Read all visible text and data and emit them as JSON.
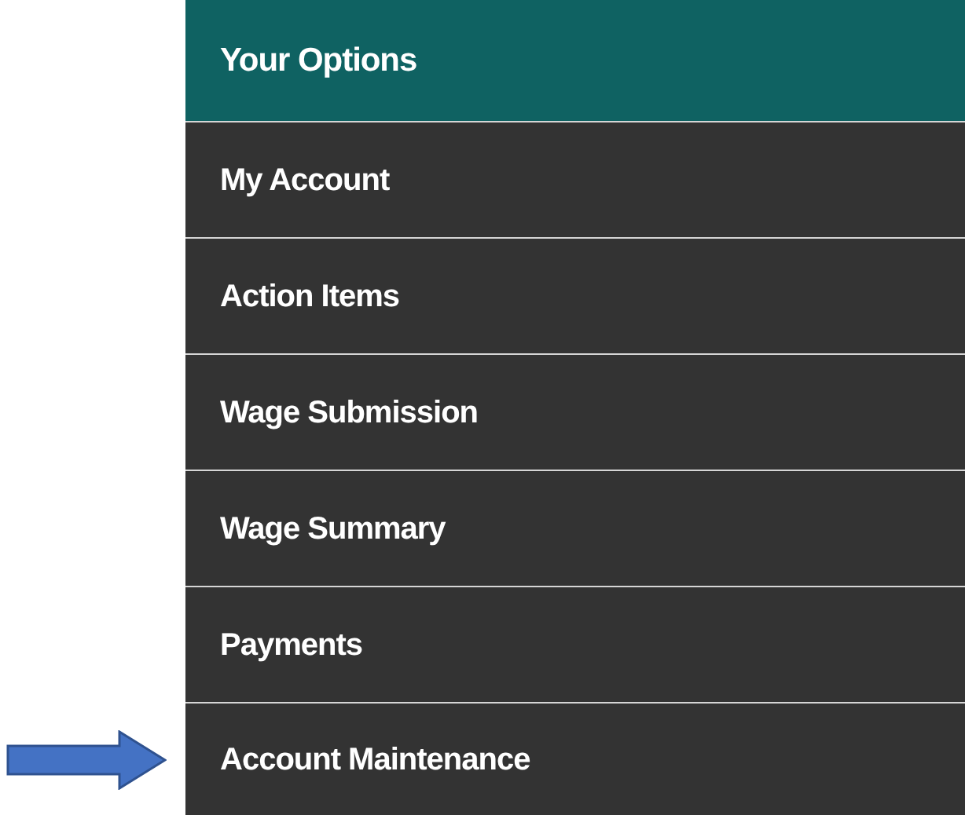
{
  "menu": {
    "title": "Your Options",
    "items": [
      {
        "label": "My Account"
      },
      {
        "label": "Action Items"
      },
      {
        "label": "Wage Submission"
      },
      {
        "label": "Wage Summary"
      },
      {
        "label": "Payments"
      },
      {
        "label": "Account Maintenance"
      }
    ]
  }
}
